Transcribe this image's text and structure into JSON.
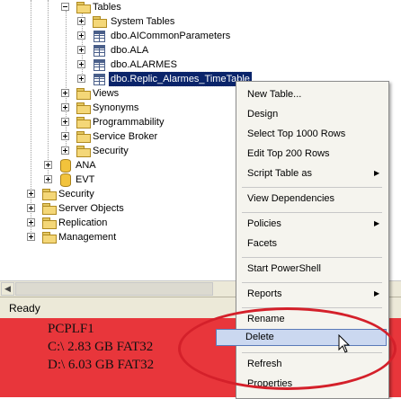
{
  "tree": {
    "tables": "Tables",
    "system_tables": "System Tables",
    "t1": "dbo.AICommonParameters",
    "t2": "dbo.ALA",
    "t3": "dbo.ALARMES",
    "t4": "dbo.Replic_Alarmes_TimeTable",
    "views": "Views",
    "synonyms": "Synonyms",
    "programmability": "Programmability",
    "service_broker": "Service Broker",
    "security_db": "Security",
    "db_ana": "ANA",
    "db_evt": "EVT",
    "security": "Security",
    "server_objects": "Server Objects",
    "replication": "Replication",
    "management": "Management"
  },
  "status": {
    "text": "Ready"
  },
  "disk": {
    "host": "PCPLF1",
    "c": "C:\\ 2.83 GB FAT32",
    "d": "D:\\ 6.03 GB FAT32"
  },
  "menu": {
    "new_table": "New Table...",
    "design": "Design",
    "select_top": "Select Top 1000 Rows",
    "edit_top": "Edit Top 200 Rows",
    "script_table": "Script Table as",
    "view_dependencies": "View Dependencies",
    "policies": "Policies",
    "facets": "Facets",
    "start_powershell": "Start PowerShell",
    "reports": "Reports",
    "rename": "Rename",
    "delete": "Delete",
    "refresh": "Refresh",
    "properties": "Properties"
  },
  "colors": {
    "selection": "#0a246a",
    "highlight": "#cbd8f0",
    "annotation": "#d4202a",
    "disk_bg": "#e8363b"
  }
}
